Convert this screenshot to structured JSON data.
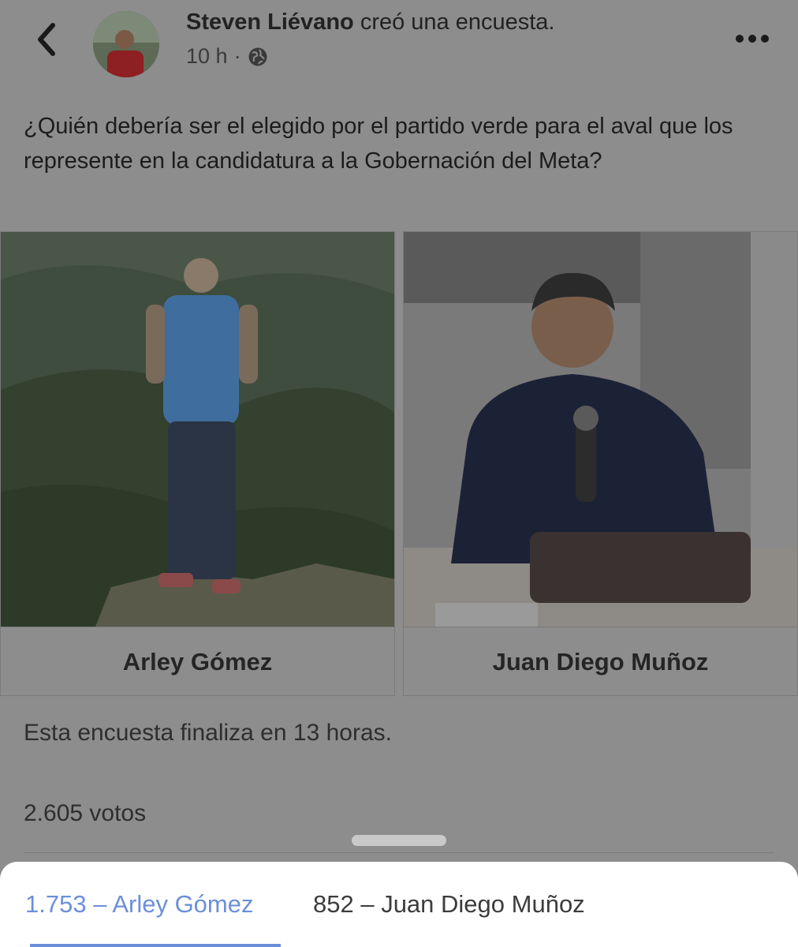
{
  "post": {
    "author": "Steven Liévano",
    "action": "creó una encuesta.",
    "time": "10 h",
    "separator": "·",
    "question": "¿Quién debería ser el elegido por el partido verde para el aval que los represente en la candidatura a la Gobernación del Meta?"
  },
  "poll": {
    "options": [
      {
        "label": "Arley Gómez"
      },
      {
        "label": "Juan Diego Muñoz"
      }
    ],
    "ends_text": "Esta encuesta finaliza en 13 horas.",
    "votes_text": "2.605 votos"
  },
  "results": {
    "tabs": [
      {
        "label": "1.753 – Arley Gómez",
        "active": true
      },
      {
        "label": "852 – Juan Diego Muñoz",
        "active": false
      }
    ]
  },
  "colors": {
    "overlay_bg": "#8d8d8d",
    "accent": "#6b8fd9",
    "sheet_bg": "#ffffff"
  },
  "icons": {
    "back": "chevron-left-icon",
    "privacy": "globe-icon",
    "more": "more-horizontal-icon"
  }
}
